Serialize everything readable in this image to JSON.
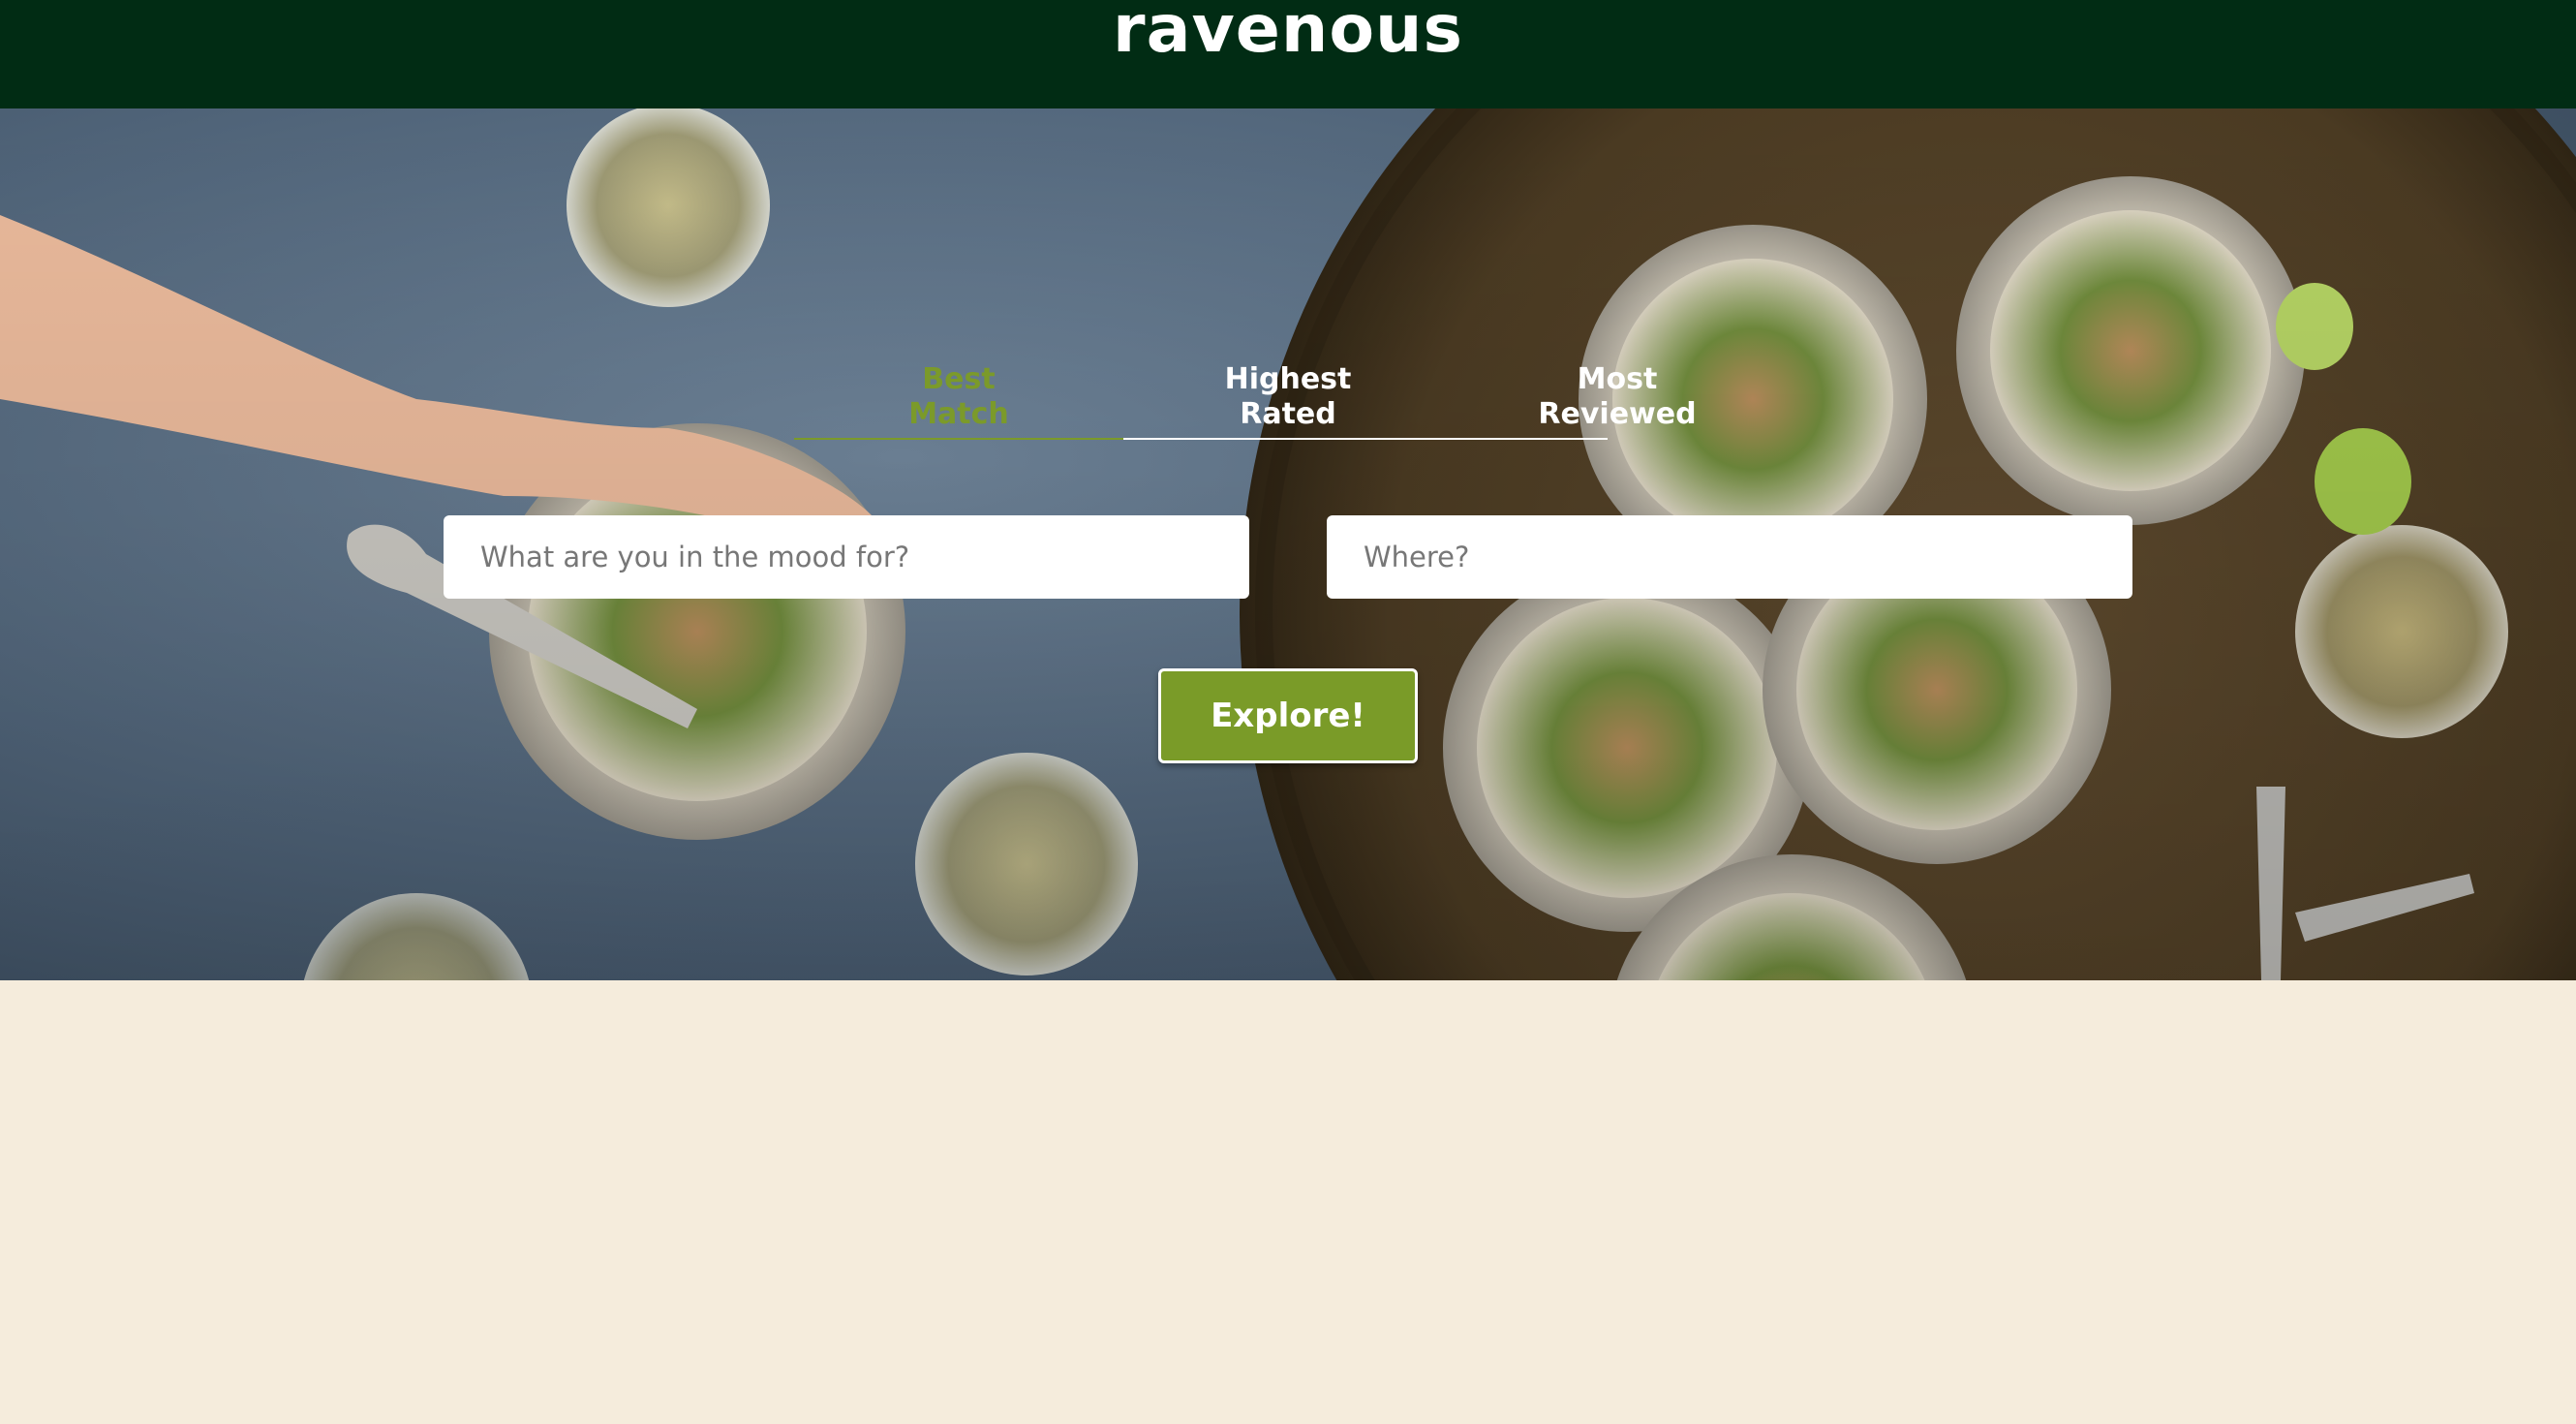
{
  "header": {
    "brand": "ravenous"
  },
  "sort_tabs": [
    {
      "label": "Best\nMatch",
      "active": true
    },
    {
      "label": "Highest\nRated",
      "active": false
    },
    {
      "label": "Most\nReviewed",
      "active": false
    }
  ],
  "search": {
    "term_placeholder": "What are you in the mood for?",
    "term_value": "",
    "location_placeholder": "Where?",
    "location_value": "",
    "submit_label": "Explore!"
  },
  "colors": {
    "header_bg": "#012c14",
    "accent": "#7a9b28",
    "page_bg": "#f5ecdc"
  }
}
